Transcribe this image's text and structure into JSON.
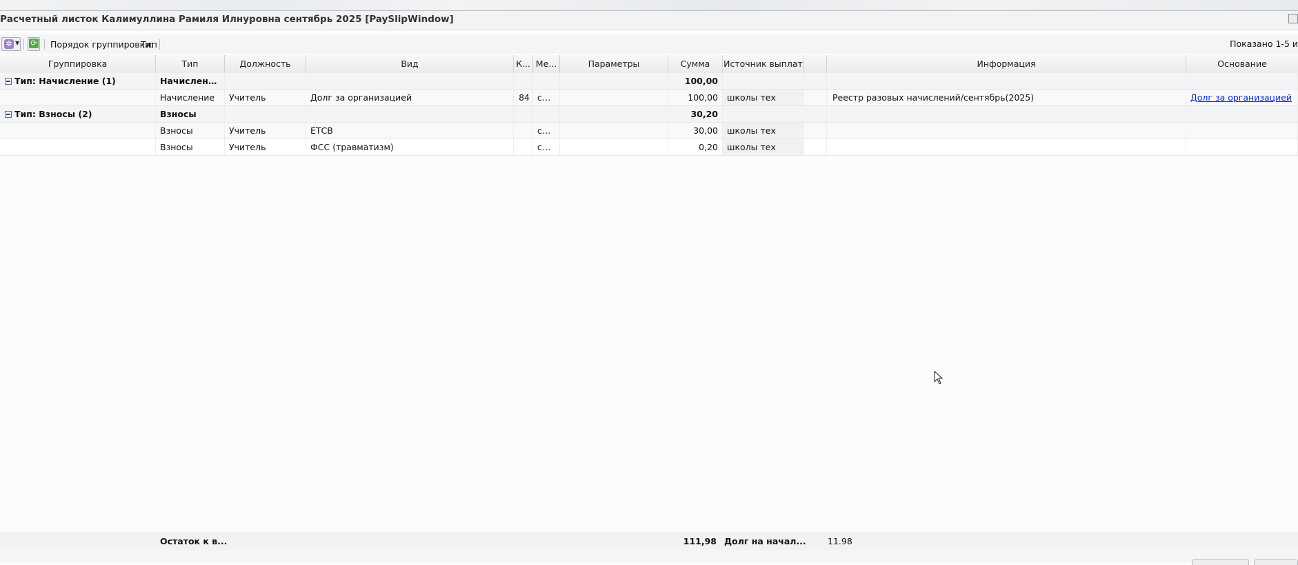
{
  "window": {
    "title": "Расчетный листок Калимуллина Рамиля Илнуровна сентябрь 2025 [PaySlipWindow]"
  },
  "toolbar": {
    "settings_icon": "gear-icon",
    "refresh_icon": "refresh-icon",
    "grouping_label": "Порядок группировки:",
    "grouping_value": "Тип",
    "paging_text": "Показано 1-5 и"
  },
  "grid": {
    "columns": [
      "Группировка",
      "Тип",
      "Должность",
      "Вид",
      "К...",
      "Ме...",
      "Параметры",
      "Сумма",
      "Источник выплат",
      "",
      "Информация",
      "Основание"
    ],
    "groups": [
      {
        "label": "Тип: Начисление (1)",
        "type": "Начисление",
        "sum": "100,00",
        "rows": [
          {
            "type": "Начисление",
            "position": "Учитель",
            "kind": "Долг за организацией",
            "k": "84",
            "me": "се...",
            "params": "",
            "sum": "100,00",
            "source": "школы тех",
            "extra": "",
            "info": "Реестр разовых начислений/сентябрь(2025)",
            "basis": "Долг за организацией"
          }
        ]
      },
      {
        "label": "Тип: Взносы (2)",
        "type": "Взносы",
        "sum": "30,20",
        "rows": [
          {
            "type": "Взносы",
            "position": "Учитель",
            "kind": "ЕТСВ",
            "k": "",
            "me": "се...",
            "params": "",
            "sum": "30,00",
            "source": "школы тех",
            "extra": "",
            "info": "",
            "basis": ""
          },
          {
            "type": "Взносы",
            "position": "Учитель",
            "kind": "ФСС (травматизм)",
            "k": "",
            "me": "се...",
            "params": "",
            "sum": "0,20",
            "source": "школы тех",
            "extra": "",
            "info": "",
            "basis": ""
          }
        ]
      }
    ]
  },
  "footer": {
    "balance_label": "Остаток к в...",
    "balance_value": "111,98",
    "debt_label": "Долг на начал...",
    "debt_value": "11.98"
  },
  "colors": {
    "link": "#0b2ccf",
    "settings_icon": "#a07fcf",
    "refresh_icon": "#5aa64a"
  }
}
